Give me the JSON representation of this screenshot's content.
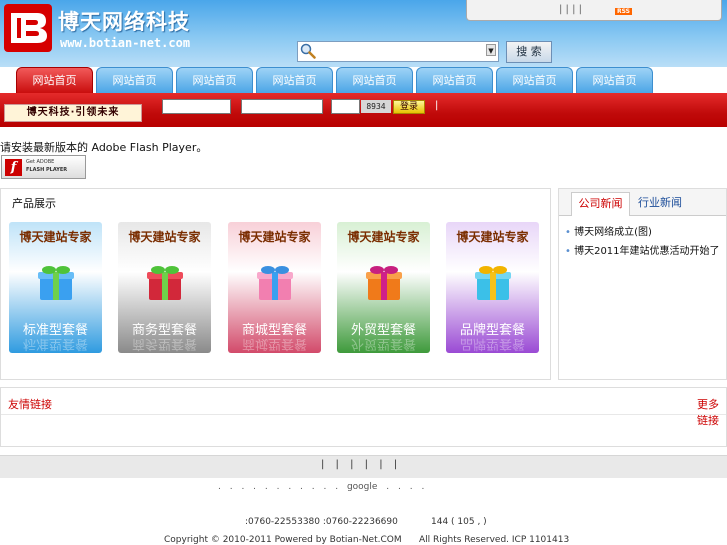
{
  "header": {
    "site_title": "博天网络科技",
    "site_url": "www.botian-net.com",
    "top_links_separators": "|     |     |     |",
    "rss_label": "RSS",
    "search_placeholder": "",
    "search_button": "搜 索"
  },
  "nav": {
    "tabs": [
      "网站首页",
      "网站首页",
      "网站首页",
      "网站首页",
      "网站首页",
      "网站首页",
      "网站首页",
      "网站首页"
    ]
  },
  "login_bar": {
    "slogan": "博天科技·引领未来",
    "captcha": "8934",
    "login_button": "登录",
    "separator": "|"
  },
  "flash": {
    "notice": "请安装最新版本的 Adobe Flash Player。",
    "badge_line1": "Get ADOBE",
    "badge_line2": "FLASH PLAYER"
  },
  "products": {
    "title": "产品展示",
    "cards": [
      {
        "head": "博天建站专家",
        "label": "标准型套餐",
        "color_top": "#bfe3f8",
        "color_bottom": "#2f9be0"
      },
      {
        "head": "博天建站专家",
        "label": "商务型套餐",
        "color_top": "#e7e7e7",
        "color_bottom": "#8a8a8a"
      },
      {
        "head": "博天建站专家",
        "label": "商城型套餐",
        "color_top": "#f8d0d8",
        "color_bottom": "#d24a6a"
      },
      {
        "head": "博天建站专家",
        "label": "外贸型套餐",
        "color_top": "#d8f0d4",
        "color_bottom": "#3e9a3b"
      },
      {
        "head": "博天建站专家",
        "label": "品牌型套餐",
        "color_top": "#e8d6f8",
        "color_bottom": "#9a4ad4"
      }
    ]
  },
  "news": {
    "tabs": [
      "公司新闻",
      "行业新闻"
    ],
    "items": [
      "博天网络成立(图)",
      "博天2011年建站优惠活动开始了"
    ]
  },
  "links": {
    "title": "友情链接",
    "more": "更多链接"
  },
  "footer": {
    "nav": "|   |   |   |   |   |",
    "links": ".   .   .   .   .   .   .   .   .   .   . google .   .   .   .",
    "phone": ":0760-22553380  :0760-22236690",
    "stats": "144 ( 105  ,    )",
    "copyright": "Copyright © 2010-2011 Powered by Botian-Net.COM",
    "rights": "All Rights Reserved.  ICP 1101413"
  },
  "colors": {
    "brand_red": "#c90d0d",
    "brand_blue": "#4aa6ea"
  }
}
